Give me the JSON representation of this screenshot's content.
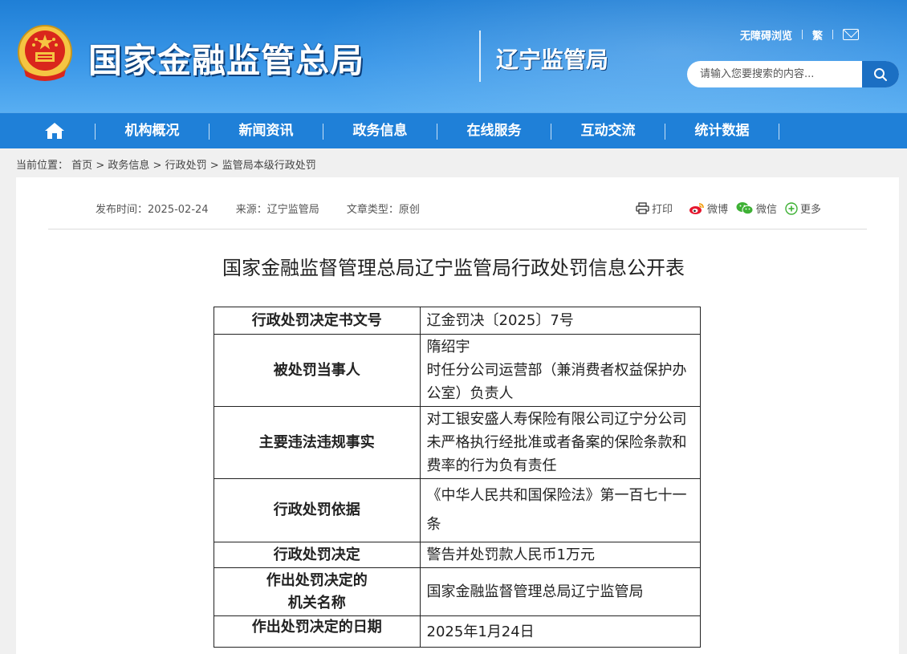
{
  "header": {
    "site_title": "国家金融监管总局",
    "sub_title": "辽宁监管局",
    "accessibility_label": "无障碍浏览",
    "traditional_label": "繁",
    "mail_icon": "mail-icon",
    "search_placeholder": "请输入您要搜索的内容...",
    "search_icon": "search-icon",
    "emblem_icon": "national-emblem-icon"
  },
  "nav": {
    "home_icon": "home-icon",
    "items": [
      {
        "label": "机构概况"
      },
      {
        "label": "新闻资讯"
      },
      {
        "label": "政务信息"
      },
      {
        "label": "在线服务"
      },
      {
        "label": "互动交流"
      },
      {
        "label": "统计数据"
      }
    ]
  },
  "breadcrumb": {
    "prefix": "当前位置：",
    "items": [
      "首页",
      "政务信息",
      "行政处罚",
      "监管局本级行政处罚"
    ],
    "separator": ">"
  },
  "meta": {
    "publish_time": "发布时间：2025-02-24",
    "source": "来源：辽宁监管局",
    "type": "文章类型：原创"
  },
  "share": {
    "print": "打印",
    "weibo": "微博",
    "wechat": "微信",
    "more": "更多"
  },
  "document": {
    "title": "国家金融监督管理总局辽宁监管局行政处罚信息公开表",
    "rows": [
      {
        "key": "行政处罚决定书文号",
        "value": "辽金罚决〔2025〕7号"
      },
      {
        "key": "被处罚当事人",
        "value_lines": [
          "隋绍宇",
          "时任分公司运营部（兼消费者权益保护办公室）负责人"
        ]
      },
      {
        "key": "主要违法违规事实",
        "value": "对工银安盛人寿保险有限公司辽宁分公司未严格执行经批准或者备案的保险条款和费率的行为负有责任"
      },
      {
        "key": "行政处罚依据",
        "value": "《中华人民共和国保险法》第一百七十一条"
      },
      {
        "key": "行政处罚决定",
        "value": "警告并处罚款人民币1万元"
      },
      {
        "key_lines": [
          "作出处罚决定的",
          "机关名称"
        ],
        "value": "国家金融监督管理总局辽宁监管局"
      },
      {
        "key": "作出处罚决定的日期",
        "value": "2025年1月24日"
      }
    ]
  },
  "colors": {
    "header_blue": "#1f7fd6",
    "nav_blue": "#1f80d8",
    "search_button": "#1b6fc3"
  }
}
